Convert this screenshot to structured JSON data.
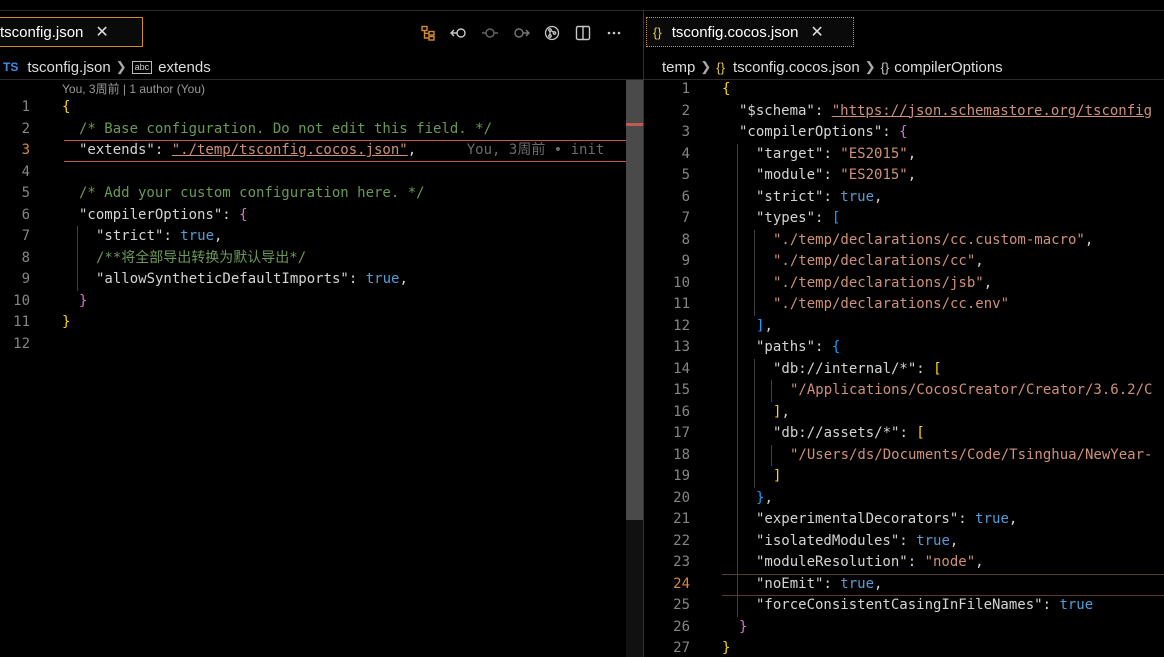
{
  "left": {
    "tab": {
      "icon": "{}",
      "label": "tsconfig.json",
      "close": "✕"
    },
    "breadcrumb": {
      "file_icon": "TS",
      "file": "tsconfig.json",
      "sym_icon": "abc",
      "symbol": "extends"
    },
    "blame": "You, 3周前 | 1 author (You)",
    "inline_blame": "You, 3周前 • init",
    "lines": [
      {
        "n": "1",
        "indent": 0,
        "tokens": [
          {
            "t": "{",
            "c": "p1"
          }
        ]
      },
      {
        "n": "2",
        "indent": 1,
        "tokens": [
          {
            "t": "/* Base configuration. Do not edit this field. */",
            "c": "c"
          }
        ]
      },
      {
        "n": "3",
        "indent": 1,
        "tokens": [
          {
            "t": "\"extends\"",
            "c": "k"
          },
          {
            "t": ": ",
            "c": "k"
          },
          {
            "t": "\"./temp/tsconfig.cocos.json\"",
            "c": "s u"
          },
          {
            "t": ",",
            "c": "k"
          }
        ]
      },
      {
        "n": "4",
        "indent": 0,
        "tokens": []
      },
      {
        "n": "5",
        "indent": 1,
        "tokens": [
          {
            "t": "/* Add your custom configuration here. */",
            "c": "c"
          }
        ]
      },
      {
        "n": "6",
        "indent": 1,
        "tokens": [
          {
            "t": "\"compilerOptions\"",
            "c": "k"
          },
          {
            "t": ": ",
            "c": "k"
          },
          {
            "t": "{",
            "c": "p2"
          }
        ]
      },
      {
        "n": "7",
        "indent": 2,
        "tokens": [
          {
            "t": "\"strict\"",
            "c": "k"
          },
          {
            "t": ": ",
            "c": "k"
          },
          {
            "t": "true",
            "c": "b"
          },
          {
            "t": ",",
            "c": "k"
          }
        ]
      },
      {
        "n": "8",
        "indent": 2,
        "tokens": [
          {
            "t": "/**将全部导出转换为默认导出*/",
            "c": "c"
          }
        ]
      },
      {
        "n": "9",
        "indent": 2,
        "tokens": [
          {
            "t": "\"allowSyntheticDefaultImports\"",
            "c": "k"
          },
          {
            "t": ": ",
            "c": "k"
          },
          {
            "t": "true",
            "c": "b"
          },
          {
            "t": ",",
            "c": "k"
          }
        ]
      },
      {
        "n": "10",
        "indent": 1,
        "tokens": [
          {
            "t": "}",
            "c": "p2"
          }
        ]
      },
      {
        "n": "11",
        "indent": 0,
        "tokens": [
          {
            "t": "}",
            "c": "p1"
          }
        ]
      },
      {
        "n": "12",
        "indent": 0,
        "tokens": []
      }
    ]
  },
  "right": {
    "tab": {
      "icon": "{}",
      "label": "tsconfig.cocos.json",
      "close": "✕"
    },
    "breadcrumb": {
      "folder": "temp",
      "file_icon": "{}",
      "file": "tsconfig.cocos.json",
      "sym_icon": "{}",
      "symbol": "compilerOptions"
    },
    "lines": [
      {
        "n": "1",
        "indent": 0,
        "tokens": [
          {
            "t": "{",
            "c": "p1"
          }
        ]
      },
      {
        "n": "2",
        "indent": 1,
        "tokens": [
          {
            "t": "\"$schema\"",
            "c": "k"
          },
          {
            "t": ": ",
            "c": "k"
          },
          {
            "t": "\"https://json.schemastore.org/tsconfig",
            "c": "s u"
          }
        ]
      },
      {
        "n": "3",
        "indent": 1,
        "tokens": [
          {
            "t": "\"compilerOptions\"",
            "c": "k"
          },
          {
            "t": ": ",
            "c": "k"
          },
          {
            "t": "{",
            "c": "p2"
          }
        ]
      },
      {
        "n": "4",
        "indent": 2,
        "tokens": [
          {
            "t": "\"target\"",
            "c": "k"
          },
          {
            "t": ": ",
            "c": "k"
          },
          {
            "t": "\"ES2015\"",
            "c": "s"
          },
          {
            "t": ",",
            "c": "k"
          }
        ]
      },
      {
        "n": "5",
        "indent": 2,
        "tokens": [
          {
            "t": "\"module\"",
            "c": "k"
          },
          {
            "t": ": ",
            "c": "k"
          },
          {
            "t": "\"ES2015\"",
            "c": "s"
          },
          {
            "t": ",",
            "c": "k"
          }
        ]
      },
      {
        "n": "6",
        "indent": 2,
        "tokens": [
          {
            "t": "\"strict\"",
            "c": "k"
          },
          {
            "t": ": ",
            "c": "k"
          },
          {
            "t": "true",
            "c": "b"
          },
          {
            "t": ",",
            "c": "k"
          }
        ]
      },
      {
        "n": "7",
        "indent": 2,
        "tokens": [
          {
            "t": "\"types\"",
            "c": "k"
          },
          {
            "t": ": ",
            "c": "k"
          },
          {
            "t": "[",
            "c": "p3"
          }
        ]
      },
      {
        "n": "8",
        "indent": 3,
        "tokens": [
          {
            "t": "\"./temp/declarations/cc.custom-macro\"",
            "c": "s"
          },
          {
            "t": ",",
            "c": "k"
          }
        ]
      },
      {
        "n": "9",
        "indent": 3,
        "tokens": [
          {
            "t": "\"./temp/declarations/cc\"",
            "c": "s"
          },
          {
            "t": ",",
            "c": "k"
          }
        ]
      },
      {
        "n": "10",
        "indent": 3,
        "tokens": [
          {
            "t": "\"./temp/declarations/jsb\"",
            "c": "s"
          },
          {
            "t": ",",
            "c": "k"
          }
        ]
      },
      {
        "n": "11",
        "indent": 3,
        "tokens": [
          {
            "t": "\"./temp/declarations/cc.env\"",
            "c": "s"
          }
        ]
      },
      {
        "n": "12",
        "indent": 2,
        "tokens": [
          {
            "t": "]",
            "c": "p3"
          },
          {
            "t": ",",
            "c": "k"
          }
        ]
      },
      {
        "n": "13",
        "indent": 2,
        "tokens": [
          {
            "t": "\"paths\"",
            "c": "k"
          },
          {
            "t": ": ",
            "c": "k"
          },
          {
            "t": "{",
            "c": "p3"
          }
        ]
      },
      {
        "n": "14",
        "indent": 3,
        "tokens": [
          {
            "t": "\"db://internal/*\"",
            "c": "k"
          },
          {
            "t": ": ",
            "c": "k"
          },
          {
            "t": "[",
            "c": "p1"
          }
        ]
      },
      {
        "n": "15",
        "indent": 4,
        "tokens": [
          {
            "t": "\"/Applications/CocosCreator/Creator/3.6.2/C",
            "c": "s"
          }
        ]
      },
      {
        "n": "16",
        "indent": 3,
        "tokens": [
          {
            "t": "]",
            "c": "p1"
          },
          {
            "t": ",",
            "c": "k"
          }
        ]
      },
      {
        "n": "17",
        "indent": 3,
        "tokens": [
          {
            "t": "\"db://assets/*\"",
            "c": "k"
          },
          {
            "t": ": ",
            "c": "k"
          },
          {
            "t": "[",
            "c": "p1"
          }
        ]
      },
      {
        "n": "18",
        "indent": 4,
        "tokens": [
          {
            "t": "\"/Users/ds/Documents/Code/Tsinghua/NewYear-",
            "c": "s"
          }
        ]
      },
      {
        "n": "19",
        "indent": 3,
        "tokens": [
          {
            "t": "]",
            "c": "p1"
          }
        ]
      },
      {
        "n": "20",
        "indent": 2,
        "tokens": [
          {
            "t": "}",
            "c": "p3"
          },
          {
            "t": ",",
            "c": "k"
          }
        ]
      },
      {
        "n": "21",
        "indent": 2,
        "tokens": [
          {
            "t": "\"experimentalDecorators\"",
            "c": "k"
          },
          {
            "t": ": ",
            "c": "k"
          },
          {
            "t": "true",
            "c": "b"
          },
          {
            "t": ",",
            "c": "k"
          }
        ]
      },
      {
        "n": "22",
        "indent": 2,
        "tokens": [
          {
            "t": "\"isolatedModules\"",
            "c": "k"
          },
          {
            "t": ": ",
            "c": "k"
          },
          {
            "t": "true",
            "c": "b"
          },
          {
            "t": ",",
            "c": "k"
          }
        ]
      },
      {
        "n": "23",
        "indent": 2,
        "tokens": [
          {
            "t": "\"moduleResolution\"",
            "c": "k"
          },
          {
            "t": ": ",
            "c": "k"
          },
          {
            "t": "\"node\"",
            "c": "s"
          },
          {
            "t": ",",
            "c": "k"
          }
        ]
      },
      {
        "n": "24",
        "indent": 2,
        "tokens": [
          {
            "t": "\"noEmit\"",
            "c": "k"
          },
          {
            "t": ": ",
            "c": "k"
          },
          {
            "t": "true",
            "c": "b"
          },
          {
            "t": ",",
            "c": "k"
          }
        ]
      },
      {
        "n": "25",
        "indent": 2,
        "tokens": [
          {
            "t": "\"forceConsistentCasingInFileNames\"",
            "c": "k"
          },
          {
            "t": ": ",
            "c": "k"
          },
          {
            "t": "true",
            "c": "b"
          }
        ]
      },
      {
        "n": "26",
        "indent": 1,
        "tokens": [
          {
            "t": "}",
            "c": "p2"
          }
        ]
      },
      {
        "n": "27",
        "indent": 0,
        "tokens": [
          {
            "t": "}",
            "c": "p1"
          }
        ]
      }
    ]
  },
  "toolbar": {
    "icons": [
      "source-control-graph-icon",
      "go-back-icon",
      "go-forward-disabled-icon",
      "go-next-icon",
      "open-changes-icon",
      "split-editor-icon",
      "more-actions-icon"
    ]
  }
}
